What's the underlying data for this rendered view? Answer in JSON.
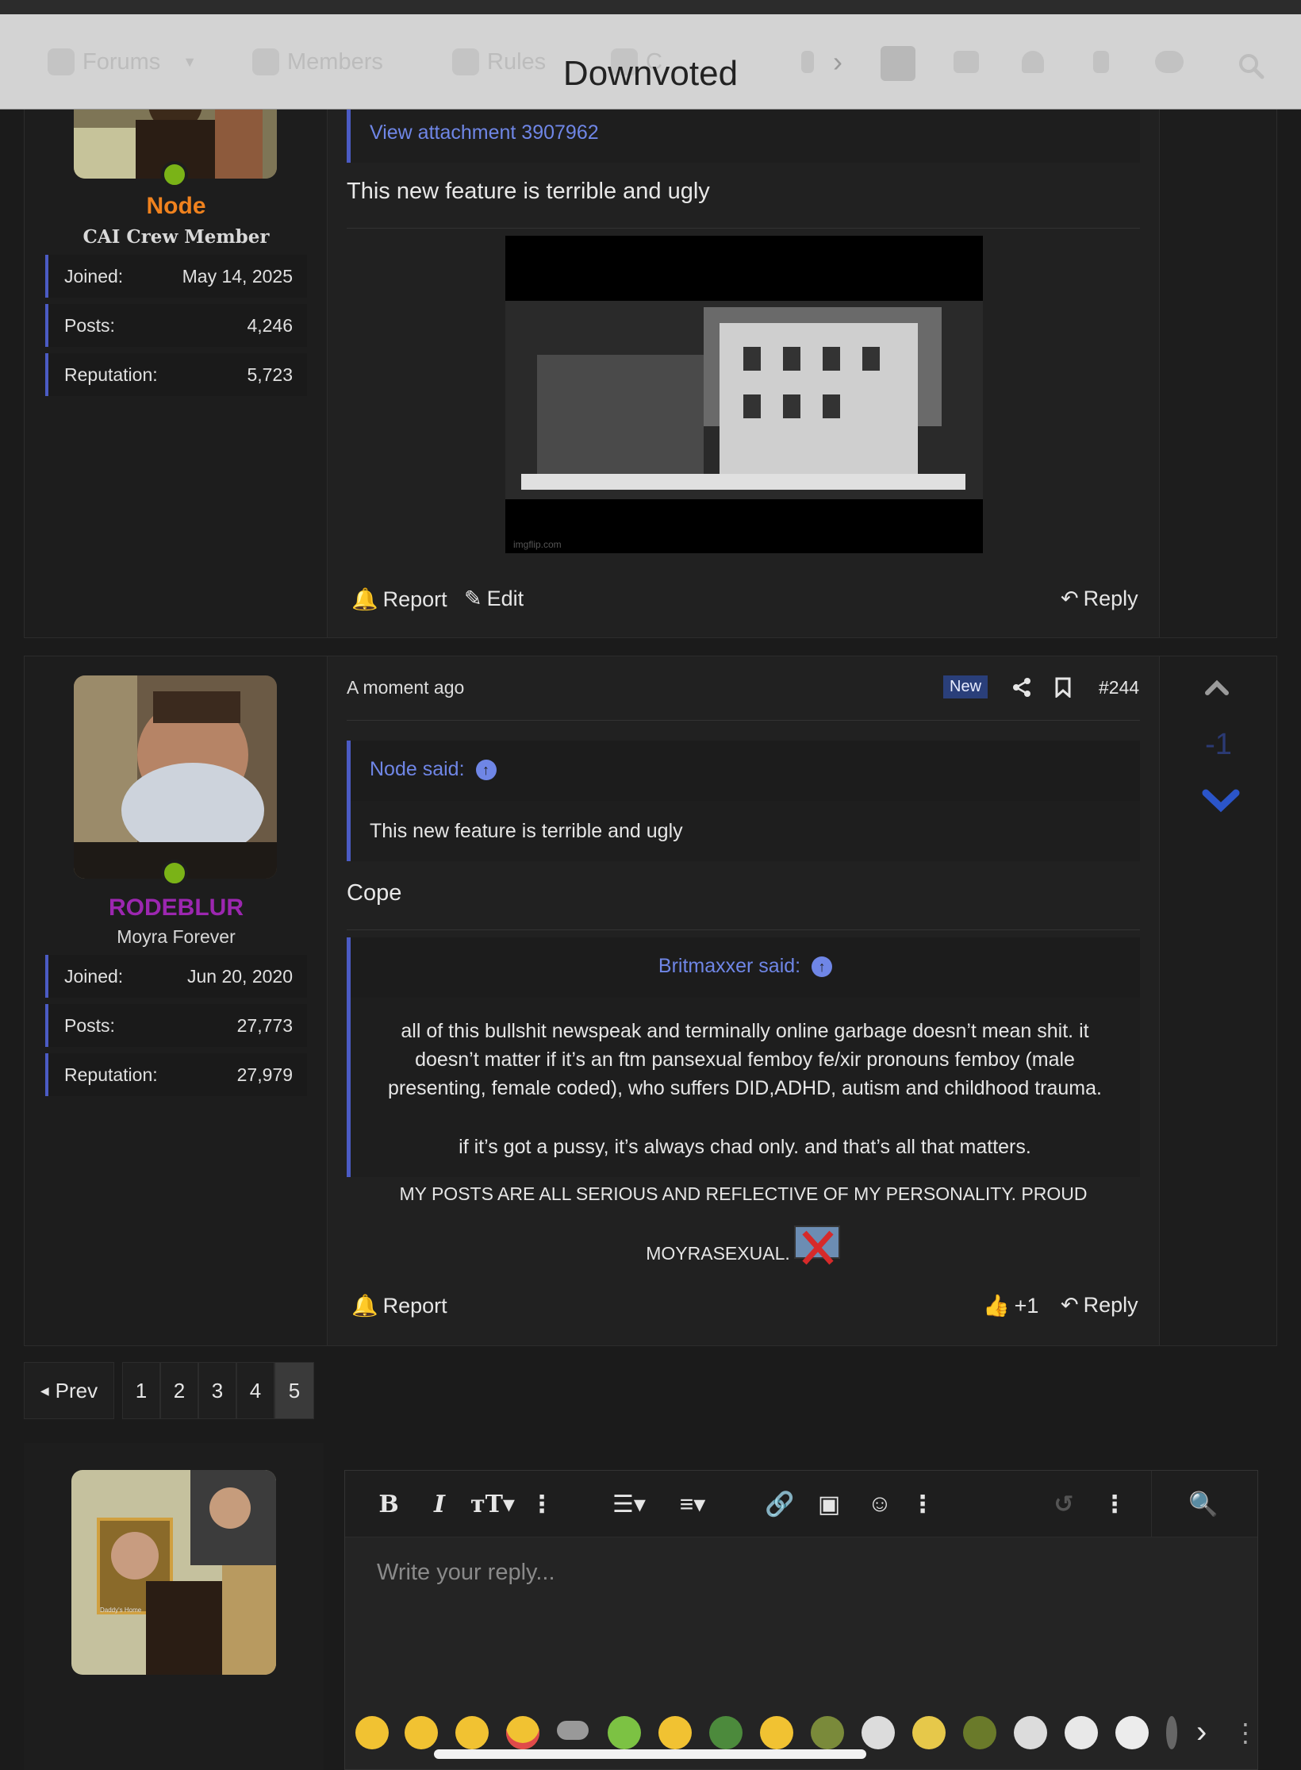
{
  "nav": {
    "title": "Downvoted",
    "forums": "Forums",
    "members": "Members",
    "rules": "Rules",
    "clipped": "C"
  },
  "post1": {
    "username": "Node",
    "username_color": "#f0821e",
    "user_title": "CAI Crew Member",
    "stats": [
      {
        "label": "Joined:",
        "value": "May 14, 2025"
      },
      {
        "label": "Posts:",
        "value": "4,246"
      },
      {
        "label": "Reputation:",
        "value": "5,723"
      }
    ],
    "attachment_link": "View attachment 3907962",
    "body": "This new feature is terrible and ugly",
    "gif_watermark": "imgflip.com",
    "actions": {
      "report": "Report",
      "edit": "Edit",
      "reply": "Reply"
    }
  },
  "post2": {
    "username": "RODEBLUR",
    "username_color": "#9c27b0",
    "user_title": "Moyra Forever",
    "stats": [
      {
        "label": "Joined:",
        "value": "Jun 20, 2020"
      },
      {
        "label": "Posts:",
        "value": "27,773"
      },
      {
        "label": "Reputation:",
        "value": "27,979"
      }
    ],
    "time": "A moment ago",
    "new_badge": "New",
    "post_number": "#244",
    "score": "-1",
    "quote1": {
      "author": "Node said:",
      "text": "This new feature is terrible and ugly"
    },
    "body": "Cope",
    "quote2": {
      "author": "Britmaxxer said:",
      "paragraph1": "all of this bullshit newspeak and terminally online garbage doesn’t mean shit. it doesn’t matter if it’s an ftm pansexual femboy fe/xir pronouns femboy (male presenting, female coded), who suffers DID,ADHD, autism and childhood trauma.",
      "paragraph2": "if it’s got a pussy, it’s always chad only. and that’s all that matters."
    },
    "signature_line1": "MY POSTS ARE ALL SERIOUS AND REFLECTIVE OF MY PERSONALITY. PROUD",
    "signature_line2": "MOYRASEXUAL.",
    "actions": {
      "report": "Report",
      "like_count": "+1",
      "reply": "Reply"
    }
  },
  "pagination": {
    "prev": "Prev",
    "pages": [
      "1",
      "2",
      "3",
      "4",
      "5"
    ],
    "current": "5"
  },
  "editor": {
    "placeholder": "Write your reply...",
    "toolbar_icons": [
      "bold-icon",
      "italic-icon",
      "text-size-icon",
      "more-icon",
      "list-icon",
      "align-icon",
      "more-icon",
      "link-icon",
      "image-icon",
      "smiley-icon",
      "more-icon",
      "undo-icon",
      "more-icon",
      "preview-icon"
    ],
    "avatar_caption": "Daddy's Home"
  },
  "colors": {
    "accent_blue": "#4b5bc4",
    "link_blue": "#6f86e6",
    "online_green": "#7ab317",
    "vote_blue": "#2b55c9"
  }
}
